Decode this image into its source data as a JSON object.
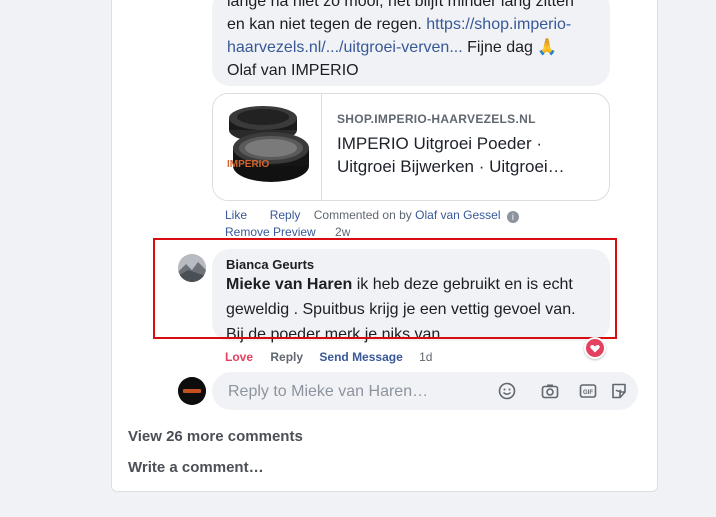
{
  "top_comment": {
    "lines": [
      {
        "text": "lange na niet zo mooi, het blijft minder lang zitten"
      },
      {
        "text": "en kan niet tegen de regen. ",
        "link": "https://shop.imperio-"
      },
      {
        "link": "haarvezels.nl/.../uitgroei-verven...",
        "text": " Fijne dag 🙏"
      },
      {
        "text": "Olaf van IMPERIO"
      }
    ]
  },
  "link_preview": {
    "domain": "SHOP.IMPERIO-HAARVEZELS.NL",
    "title_line1": "IMPERIO Uitgroei Poeder ·",
    "title_line2": "Uitgroei Bijwerken · Uitgroei…",
    "logo_text": "IMPERIO"
  },
  "top_actions": {
    "like": "Like",
    "reply": "Reply",
    "commented_on_prefix": "Commented on by",
    "commenter": "Olaf van Gessel",
    "remove_preview": "Remove Preview",
    "time": "2w"
  },
  "reply_comment": {
    "author": "Bianca Geurts",
    "mention": "Mieke van Haren",
    "line1_rest": " ik heb deze gebruikt en is echt",
    "line2": "geweldig . Spuitbus krijg je een vettig gevoel van.",
    "line3": "Bij de poeder merk je niks van"
  },
  "reply_actions": {
    "love": "Love",
    "reply": "Reply",
    "send_message": "Send Message",
    "time": "1d"
  },
  "reply_box": {
    "placeholder": "Reply to Mieke van Haren…",
    "icons": [
      "emoji-icon",
      "camera-icon",
      "gif-icon",
      "sticker-icon"
    ]
  },
  "footer": {
    "view_more": "View 26 more comments",
    "write_comment": "Write a comment…"
  },
  "colors": {
    "link": "#385898",
    "love": "#e4405f",
    "highlight_box": "#d80d10"
  }
}
